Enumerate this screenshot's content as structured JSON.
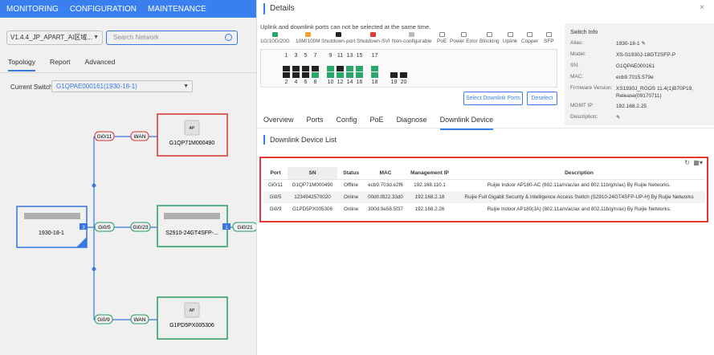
{
  "topnav": {
    "monitoring": "MONITORING",
    "configuration": "CONFIGURATION",
    "maintenance": "MAINTENANCE"
  },
  "left": {
    "version": "V1.4.4_JP_APART_AI区域...",
    "search_placeholder": "Search Network",
    "tabs": [
      "Topology",
      "Report",
      "Advanced"
    ],
    "current_switch_label": "Current Switch",
    "current_switch": "G1QPAE000161(1930-18-1)"
  },
  "topo": {
    "root": "1930-18-1",
    "ap1": "G1QP71M000490",
    "sw": "S2910-24GT4SFP-...",
    "ap2": "G1PD5PX005306",
    "ap_tag": "AP",
    "gi011": "Gi0/11",
    "gi05": "Gi0/5",
    "gi09": "Gi0/9",
    "gi023": "Gi0/23",
    "gi021": "Gi0/21",
    "wan": "WAN",
    "badge_left": "3",
    "badge_right": "1"
  },
  "details": {
    "title": "Details",
    "close": "×",
    "note": "Uplink and downlink ports can not be selected at the same time.",
    "legend": [
      "1G/10G/20G",
      "10M/100M",
      "Shutdown-port",
      "Shutdown-SVI",
      "Non-configurable",
      "PoE",
      "Power Error",
      "Blocking",
      "Uplink",
      "Copper",
      "SFP"
    ],
    "legend_colors": [
      "#2aa86a",
      "#f0a030",
      "#222222",
      "#e53935",
      "#bbbbbb"
    ],
    "ports_top": [
      "1",
      "3",
      "5",
      "7",
      "9",
      "11",
      "13",
      "15",
      "17"
    ],
    "ports_bottom": [
      "2",
      "4",
      "6",
      "8",
      "10",
      "12",
      "14",
      "16",
      "18",
      "19",
      "20"
    ],
    "btn_select": "Select Downlink Ports",
    "btn_deselect": "Deselect",
    "tabs": [
      "Overview",
      "Ports",
      "Config",
      "PoE",
      "Diagnose",
      "Downlink Device"
    ],
    "section": "Downlink Device List"
  },
  "swinfo": {
    "header": "Switch Info",
    "alias_k": "Alias:",
    "alias": "1930-18-1",
    "model_k": "Model:",
    "model": "XS-S1930J-18GT2SFP-P",
    "sn_k": "SN:",
    "sn": "G1QPAE000161",
    "mac_k": "MAC:",
    "mac": "ecb9.7015.579e",
    "fw_k": "Firmware Version:",
    "fw": "XS1930J_RGOS 11.4(1)B70P19, Release(09170711)",
    "ip_k": "MGMT IP:",
    "ip": "192.168.2.25",
    "desc_k": "Description:"
  },
  "table": {
    "headers": [
      "Port",
      "SN",
      "Status",
      "MAC",
      "Management IP",
      "Description"
    ],
    "rows": [
      [
        "Gi0/11",
        "G1QP71M000490",
        "Offline",
        "ecb9.703d.e2f6",
        "192.168.110.1",
        "Ruijie Indoor AP180-AC (802.11a/n/ac/ax and 802.11b/g/n/ax) By Ruijie Networks."
      ],
      [
        "Gi0/5",
        "1234942570020",
        "Online",
        "00d0.f822.33d0",
        "192.168.2.18",
        "Ruijie Full Gigabit Security & Intelligence Access Switch (S2910-24GT4SFP-UP-H) By Ruijie Networks"
      ],
      [
        "Gi0/9",
        "G1PD5PX005306",
        "Online",
        "300d.9e58.5f37",
        "192.168.2.26",
        "Ruijie Indoor AP180(JA) (802.11a/n/ac/ax and 802.11b/g/n/ax) By Ruijie Networks."
      ]
    ]
  }
}
